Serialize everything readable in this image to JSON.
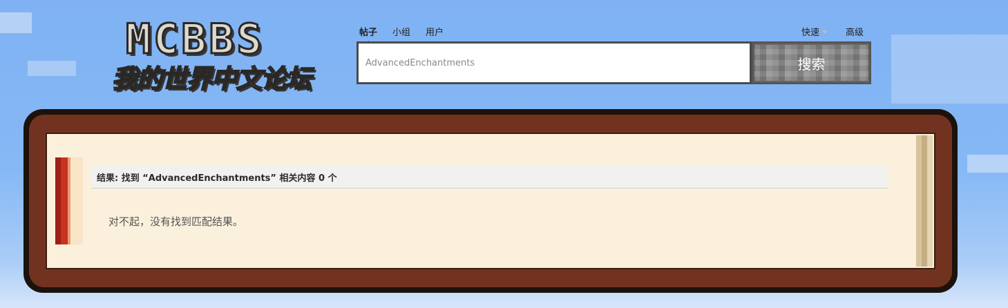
{
  "logo": {
    "word": "MCBBS",
    "subtitle": "我的世界中文论坛"
  },
  "search": {
    "tabs": [
      {
        "label": "帖子",
        "active": true
      },
      {
        "label": "小组",
        "active": false
      },
      {
        "label": "用户",
        "active": false
      }
    ],
    "quick_label": "快速",
    "advanced_label": "高级",
    "query": "AdvancedEnchantments",
    "button_label": "搜索"
  },
  "results": {
    "header": "结果: 找到 “AdvancedEnchantments” 相关内容 0 个",
    "empty_message": "对不起，没有找到匹配结果。"
  },
  "colors": {
    "sky": "#7fb2f4",
    "frame_brown": "#713320",
    "panel_cream": "#faf0dc",
    "ribbon_red": "#c8321e"
  }
}
